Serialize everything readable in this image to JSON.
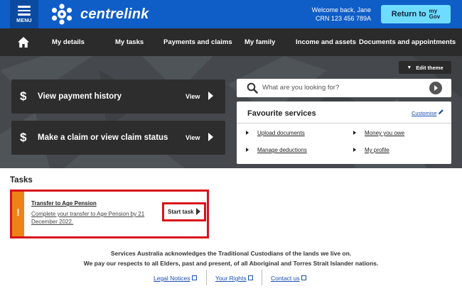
{
  "header": {
    "menu_label": "MENU",
    "brand": "centrelink",
    "welcome_line": "Welcome back, Jane",
    "crn_line": "CRN 123 456 789A",
    "return_label": "Return to",
    "mygov_top": "my",
    "mygov_bottom": "Gov",
    "brand_color": "#0f5dc7",
    "return_button_color": "#6fdcff"
  },
  "nav": {
    "home_icon": "home-icon",
    "items": [
      "My details",
      "My tasks",
      "Payments and claims",
      "My family",
      "Income and assets",
      "Documents and appointments"
    ]
  },
  "hero": {
    "edit_theme_label": "Edit theme",
    "actions": [
      {
        "icon": "dollar-icon",
        "symbol": "$",
        "label": "View payment history",
        "view_label": "View"
      },
      {
        "icon": "dollar-icon",
        "symbol": "$",
        "label": "Make a claim or view claim status",
        "view_label": "View"
      }
    ],
    "search": {
      "placeholder": "What are you looking for?"
    },
    "favourites": {
      "title": "Favourite services",
      "customise_label": "Customise",
      "links": [
        "Upload documents",
        "Money you owe",
        "Manage deductions",
        "My profile"
      ]
    }
  },
  "tasks": {
    "heading": "Tasks",
    "items": [
      {
        "title": "Transfer to Age Pension",
        "description": "Complete your transfer to Age Pension by 21 December 2022.",
        "button_label": "Start task",
        "status_color": "#ef8217",
        "highlight_color": "#d9121b"
      }
    ]
  },
  "footer": {
    "ack_line1": "Services Australia acknowledges the Traditional Custodians of the lands we live on.",
    "ack_line2": "We pay our respects to all Elders, past and present, of all Aboriginal and Torres Strait Islander nations.",
    "links": [
      "Legal Notices",
      "Your Rights",
      "Contact us"
    ]
  }
}
